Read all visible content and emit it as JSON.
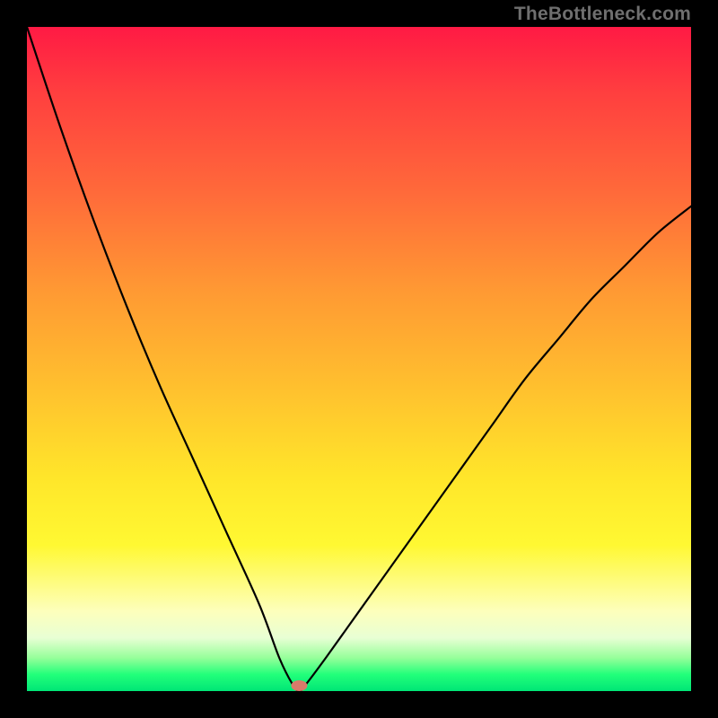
{
  "watermark": "TheBottleneck.com",
  "colors": {
    "frame_bg": "#000000",
    "gradient_top": "#ff1a44",
    "gradient_mid": "#ffe62a",
    "gradient_bottom": "#00e676",
    "curve": "#000000",
    "marker": "#d97a6a",
    "watermark_text": "#6f6f6f"
  },
  "chart_data": {
    "type": "line",
    "title": "",
    "xlabel": "",
    "ylabel": "",
    "xlim": [
      0,
      100
    ],
    "ylim": [
      0,
      100
    ],
    "x": [
      0,
      5,
      10,
      15,
      20,
      25,
      30,
      35,
      38,
      40,
      41,
      42,
      45,
      50,
      55,
      60,
      65,
      70,
      75,
      80,
      85,
      90,
      95,
      100
    ],
    "values": [
      100,
      85,
      71,
      58,
      46,
      35,
      24,
      13,
      5,
      1,
      0,
      1,
      5,
      12,
      19,
      26,
      33,
      40,
      47,
      53,
      59,
      64,
      69,
      73
    ],
    "minimum_x": 41,
    "grid": false,
    "legend": false
  }
}
